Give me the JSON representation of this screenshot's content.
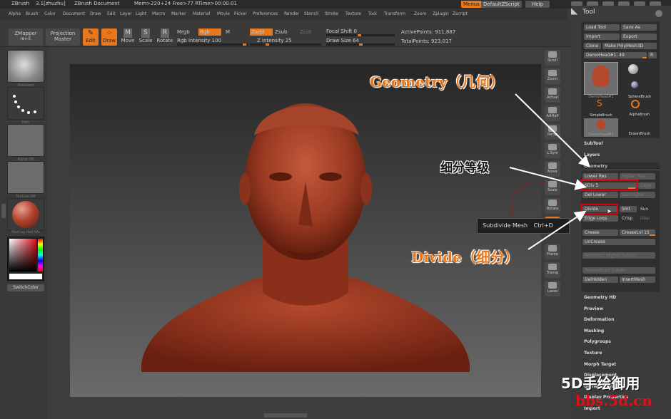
{
  "titlebar": {
    "app": "ZBrush",
    "version": "3.1[zhuzhu]",
    "doc": "ZBrush Document",
    "mem": "Mem>220+24 Free>77 RTime>00:00:01",
    "menus": "Menus",
    "script": "DefaultZScript",
    "help": "Help"
  },
  "menubar": [
    "Alpha",
    "Brush",
    "Color",
    "Document",
    "Draw",
    "Edit",
    "Layer",
    "Light",
    "Macro",
    "Marker",
    "Material",
    "Movie",
    "Picker",
    "Preferences",
    "Render",
    "Stencil",
    "Stroke",
    "Texture",
    "Tool",
    "Transform",
    "Zoom",
    "Zplugin",
    "Zscript"
  ],
  "toolbar": {
    "zmapper": "ZMapper",
    "zmapper_rev": "rev-E",
    "projection": "Projection",
    "master": "Master",
    "edit": "Edit",
    "draw": "Draw",
    "move": "Move",
    "scale": "Scale",
    "rotate": "Rotate",
    "mrgb": "Mrgb",
    "rgb": "Rgb",
    "m": "M",
    "rgb_intensity": "Rgb Intensity 100",
    "zadd": "Zadd",
    "zsub": "Zsub",
    "zcut": "Zcut",
    "z_intensity": "Z Intensity 25",
    "focal_shift": "Focal Shift 0",
    "draw_size": "Draw Size 64",
    "active_points": "ActivePoints: 911,887",
    "total_points": "TotalPoints: 923,017"
  },
  "left": {
    "standard": "Standard",
    "dots": "Dots",
    "alpha_off": "Alpha Off",
    "texture_off": "Texture Off",
    "matcap": "MatCap Red Wa",
    "switchcolor": "SwitchColor"
  },
  "right_icons": [
    "Scroll",
    "Zoom",
    "Actual",
    "AAHalf",
    "Persp",
    "L.Sym",
    "Move",
    "Scale",
    "Rotate",
    "Local",
    "Frame",
    "Transp",
    "Lasso"
  ],
  "tooltip": {
    "label": "Subdivide Mesh",
    "shortcut": "Ctrl+D"
  },
  "toolpanel": {
    "title": "Tool",
    "load_tool": "Load Tool",
    "save_as": "Save As",
    "import": "Import",
    "export": "Export",
    "clone": "Clone",
    "make_polymesh": "Make PolyMesh3D",
    "demohead_slider": "DemoHead#1. 49",
    "r": "R",
    "items": [
      "DemoHead#1",
      "SphereBrush",
      "AlphaBrush",
      "SimpleBrush",
      "EraserBrush",
      "DemoHead#1"
    ],
    "subtool": "SubTool",
    "layers": "Layers",
    "geometry": "Geometry",
    "lower_res": "Lower Res",
    "higher_res": "Higher Res",
    "sdiv": "SDiv 5",
    "cage": "Cage",
    "del_lower": "Del Lower",
    "del_higher": "Del Higher",
    "divide": "Divide",
    "smt": "Smt",
    "suv": "Suv",
    "edge_loop": "Edge Loop",
    "crisp": "Crisp",
    "disp": "Disp",
    "crease": "Crease",
    "crease_lvl": "CreaseLvl 15",
    "uncrease": "UnCrease",
    "reproject": "Reproject Higher Subdiv",
    "reconstruct": "Reconstruct Subdiv",
    "delhidden": "DelHidden",
    "insertmesh": "InsertMesh",
    "sections": [
      "Geometry HD",
      "Preview",
      "Deformation",
      "Masking",
      "Polygroups",
      "Texture",
      "Morph Target",
      "Displacement",
      "Unified Skin",
      "Display Properties",
      "Import"
    ]
  },
  "annotations": {
    "geometry": "Geometry（几何）",
    "subdiv_level": "细分等级",
    "divide": "Divide（细分）"
  },
  "watermark": {
    "line1": "5D手绘御用",
    "line2": "bbs.5d.cn"
  },
  "colors": {
    "accent": "#e8781d",
    "highlight_box": "#e00010",
    "watermark_red": "#e0101a"
  }
}
